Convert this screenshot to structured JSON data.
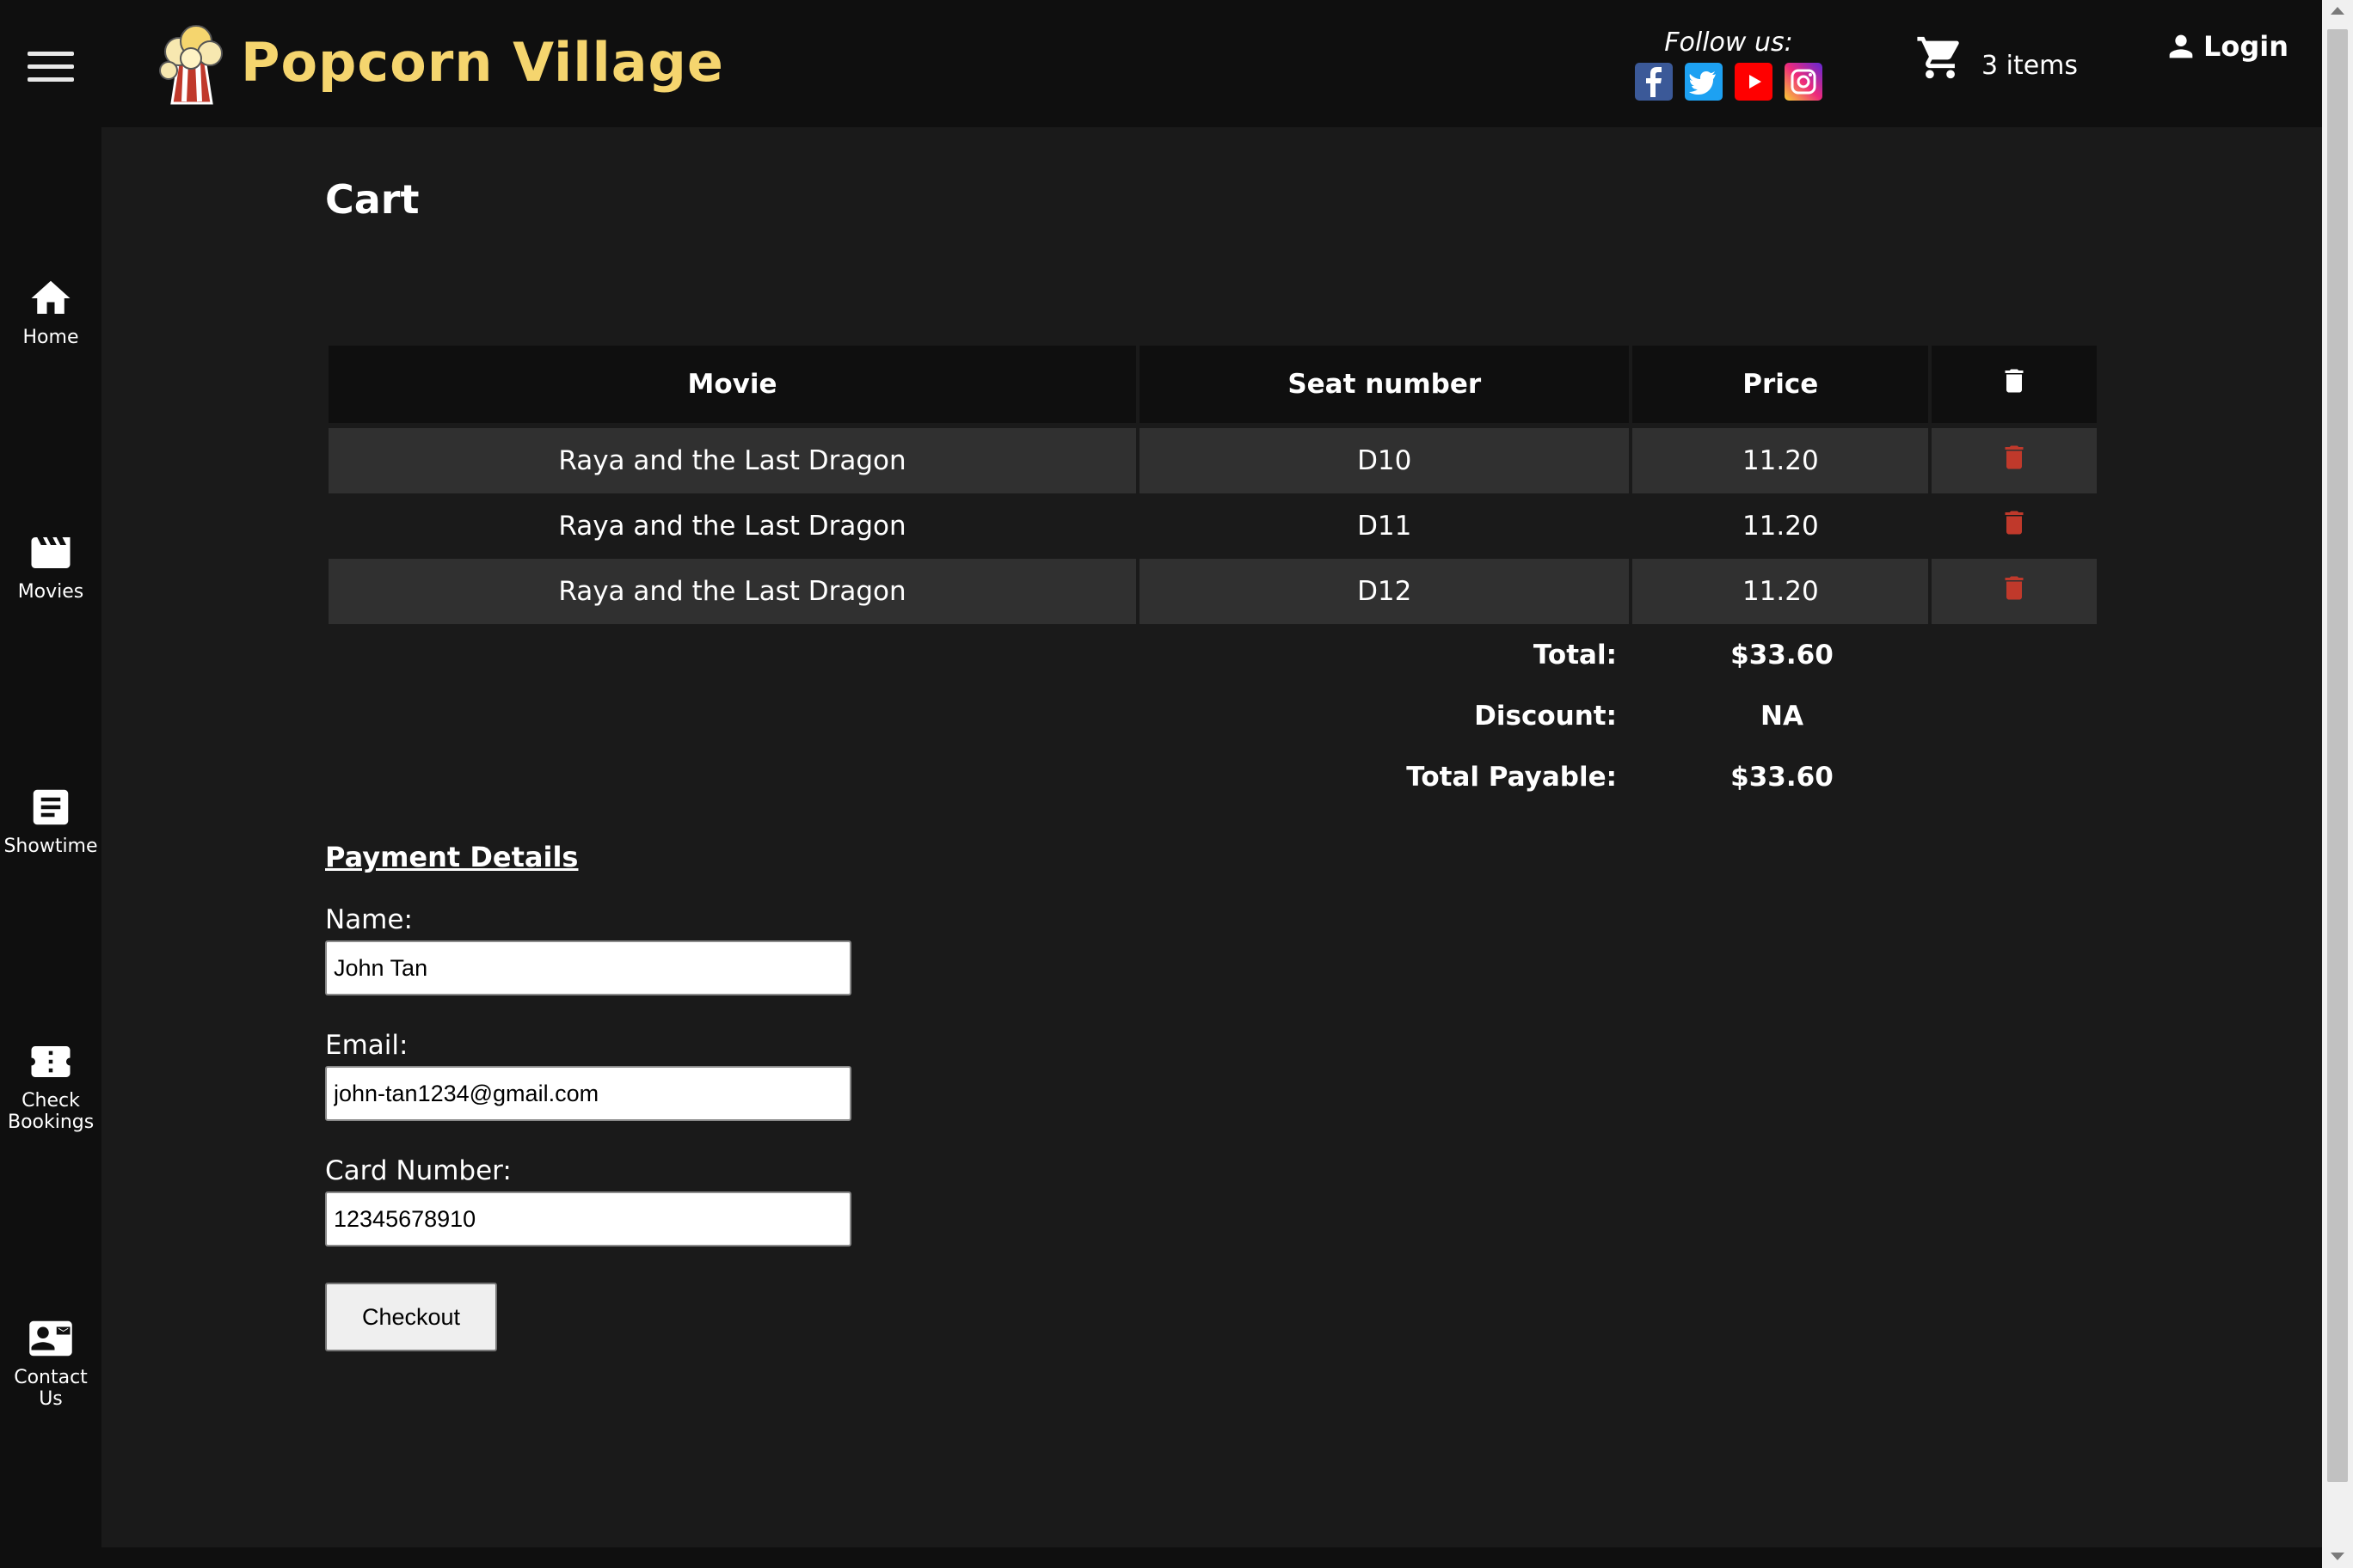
{
  "header": {
    "brand": "Popcorn Village",
    "follow_label": "Follow us:",
    "cart_count": "3 items",
    "login_label": "Login"
  },
  "sidebar": {
    "items": [
      {
        "label": "Home",
        "icon": "home-icon"
      },
      {
        "label": "Movies",
        "icon": "clapperboard-icon"
      },
      {
        "label": "Showtime",
        "icon": "schedule-icon"
      },
      {
        "label": "Check Bookings",
        "icon": "ticket-icon"
      },
      {
        "label": "Contact Us",
        "icon": "contact-card-icon"
      }
    ]
  },
  "main": {
    "title": "Cart",
    "table": {
      "headers": [
        "Movie",
        "Seat number",
        "Price"
      ],
      "rows": [
        {
          "movie": "Raya and the Last Dragon",
          "seat": "D10",
          "price": "11.20"
        },
        {
          "movie": "Raya and the Last Dragon",
          "seat": "D11",
          "price": "11.20"
        },
        {
          "movie": "Raya and the Last Dragon",
          "seat": "D12",
          "price": "11.20"
        }
      ]
    },
    "summary": {
      "total_label": "Total:",
      "total_value": "$33.60",
      "discount_label": "Discount:",
      "discount_value": "NA",
      "payable_label": "Total Payable:",
      "payable_value": "$33.60"
    },
    "payment": {
      "title": "Payment Details",
      "name_label": "Name:",
      "name_value": "John Tan",
      "email_label": "Email:",
      "email_value": "john-tan1234@gmail.com",
      "card_label": "Card Number:",
      "card_value": "12345678910",
      "checkout_label": "Checkout"
    }
  },
  "colors": {
    "brand": "#f5d56e",
    "delete_icon": "#c0392b",
    "background": "#1a1a1a",
    "header_bg": "#0f0f0f"
  }
}
